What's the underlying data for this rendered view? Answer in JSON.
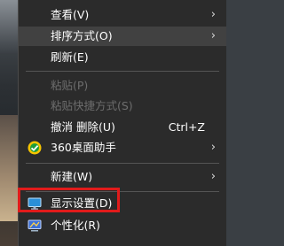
{
  "menu": {
    "items": [
      {
        "label": "查看(V)",
        "has_submenu": true,
        "enabled": true
      },
      {
        "label": "排序方式(O)",
        "has_submenu": true,
        "enabled": true
      },
      {
        "label": "刷新(E)",
        "has_submenu": false,
        "enabled": true
      },
      {
        "label": "粘贴(P)",
        "has_submenu": false,
        "enabled": false
      },
      {
        "label": "粘贴快捷方式(S)",
        "has_submenu": false,
        "enabled": false
      },
      {
        "label": "撤消 删除(U)",
        "shortcut": "Ctrl+Z",
        "has_submenu": false,
        "enabled": true
      },
      {
        "label": "360桌面助手",
        "icon": "360-desktop-assistant-icon",
        "has_submenu": true,
        "enabled": true
      },
      {
        "label": "新建(W)",
        "has_submenu": true,
        "enabled": true
      },
      {
        "label": "显示设置(D)",
        "icon": "display-settings-icon",
        "has_submenu": false,
        "enabled": true,
        "highlighted_by": "red-outline"
      },
      {
        "label": "个性化(R)",
        "icon": "personalize-icon",
        "has_submenu": false,
        "enabled": true
      }
    ],
    "arrow_glyph": "›"
  },
  "colors": {
    "menu_background": "#2b2b2b",
    "text": "#ffffff",
    "disabled_text": "#6d6d6d",
    "annotation_outline": "#e11b1b"
  }
}
